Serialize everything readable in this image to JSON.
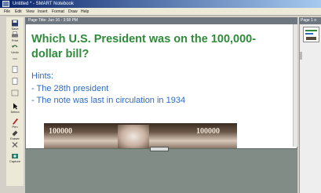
{
  "window": {
    "title": "Untitled * - SMART Notebook"
  },
  "menu": [
    "File",
    "Edit",
    "View",
    "Insert",
    "Format",
    "Draw",
    "Help"
  ],
  "toolbar": {
    "items": [
      {
        "icon": "save-icon",
        "label": "Save"
      },
      {
        "icon": "print-icon",
        "label": "Print"
      },
      {
        "icon": "undo-icon",
        "label": "Undo"
      },
      {
        "icon": "new-page-icon",
        "label": ""
      },
      {
        "icon": "delete-icon",
        "label": ""
      },
      {
        "icon": "select-icon",
        "label": "Select"
      },
      {
        "icon": "pen-icon",
        "label": "Pen"
      },
      {
        "icon": "eraser-icon",
        "label": "Eraser"
      },
      {
        "icon": "close-icon",
        "label": ""
      },
      {
        "icon": "capture-icon",
        "label": "Capture"
      }
    ]
  },
  "page": {
    "tab_title": "Page Title: Jun 16 - 3:58 PM",
    "question": "Which U.S. President was on the 100,000-dollar bill?",
    "hints_title": "Hints:",
    "hints": [
      "- The 28th president",
      "- The note was last in circulation in 1934"
    ],
    "bill_denomination": "100000"
  },
  "sorter": {
    "title": "Page 1 o"
  },
  "colors": {
    "question": "#2e8b3a",
    "hints": "#2e6bc4",
    "titlebar": "#0a246a",
    "overlay": "#818c87"
  }
}
